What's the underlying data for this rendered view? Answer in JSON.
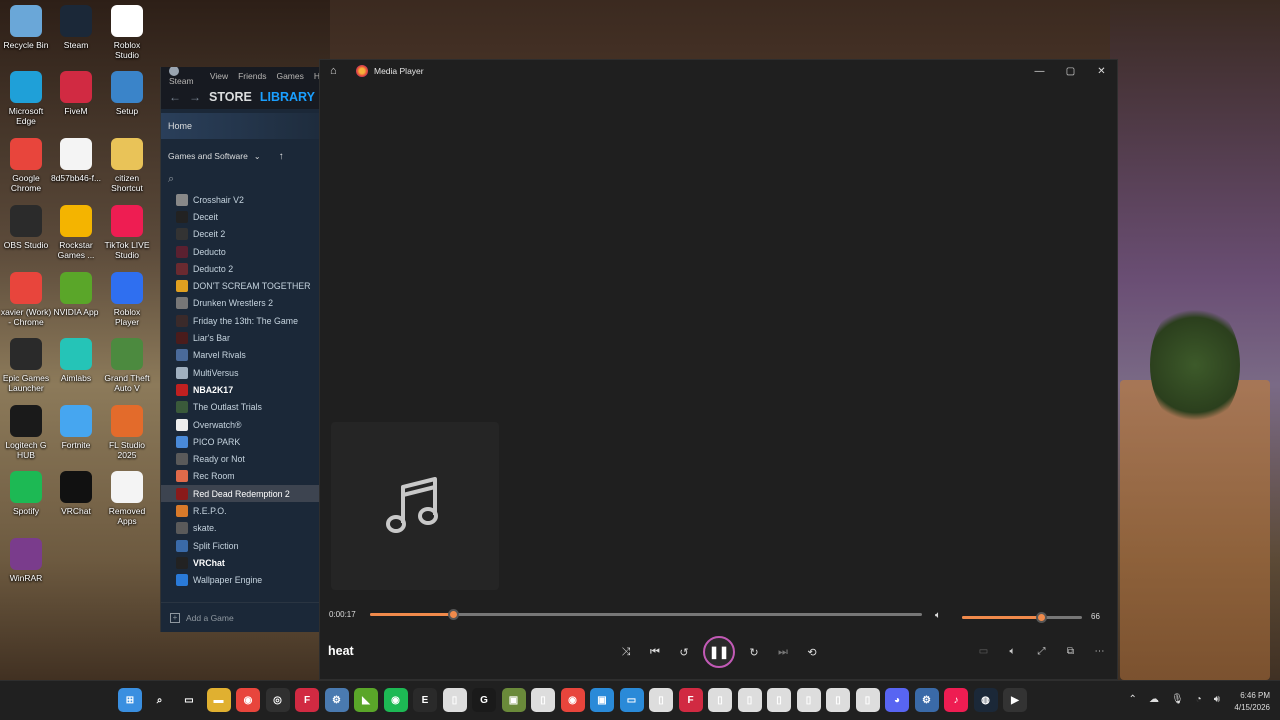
{
  "desktop": {
    "icons": [
      {
        "label": "Recycle Bin",
        "icon": "recycle-bin-icon",
        "color": "#6aa7d8"
      },
      {
        "label": "Steam",
        "icon": "steam-icon",
        "color": "#1b2838"
      },
      {
        "label": "Roblox Studio",
        "icon": "roblox-studio-icon",
        "color": "#ffffff"
      },
      {
        "label": "Microsoft Edge",
        "icon": "edge-icon",
        "color": "#1fa0d8"
      },
      {
        "label": "FiveM",
        "icon": "fivem-icon",
        "color": "#d12a42"
      },
      {
        "label": "Setup",
        "icon": "setup-icon",
        "color": "#3a84c9"
      },
      {
        "label": "Google Chrome",
        "icon": "chrome-icon",
        "color": "#e8453c"
      },
      {
        "label": "8d57bb46-f...",
        "icon": "file-icon",
        "color": "#f4f4f4"
      },
      {
        "label": "citizen Shortcut",
        "icon": "folder-icon",
        "color": "#e9c358"
      },
      {
        "label": "OBS Studio",
        "icon": "obs-icon",
        "color": "#2b2b2b"
      },
      {
        "label": "Rockstar Games ...",
        "icon": "rockstar-icon",
        "color": "#f4b400"
      },
      {
        "label": "TikTok LIVE Studio",
        "icon": "tiktok-icon",
        "color": "#ee1d52"
      },
      {
        "label": "xavier (Work) - Chrome",
        "icon": "chrome-profile-icon",
        "color": "#e8453c"
      },
      {
        "label": "NVIDIA App",
        "icon": "nvidia-icon",
        "color": "#5aa629"
      },
      {
        "label": "Roblox Player",
        "icon": "roblox-icon",
        "color": "#2f6ff0"
      },
      {
        "label": "Epic Games Launcher",
        "icon": "epic-icon",
        "color": "#2a2a2a"
      },
      {
        "label": "Aimlabs",
        "icon": "aimlabs-icon",
        "color": "#25c4b7"
      },
      {
        "label": "Grand Theft Auto V",
        "icon": "gta-icon",
        "color": "#4c8a3f"
      },
      {
        "label": "Logitech G HUB",
        "icon": "logitech-icon",
        "color": "#1a1a1a"
      },
      {
        "label": "Fortnite",
        "icon": "fortnite-icon",
        "color": "#46a6f0"
      },
      {
        "label": "FL Studio 2025",
        "icon": "fl-studio-icon",
        "color": "#e36b2b"
      },
      {
        "label": "Spotify",
        "icon": "spotify-icon",
        "color": "#1db954"
      },
      {
        "label": "VRChat",
        "icon": "vrchat-icon",
        "color": "#111111"
      },
      {
        "label": "Removed Apps",
        "icon": "removed-apps-icon",
        "color": "#f4f4f4"
      },
      {
        "label": "WinRAR",
        "icon": "winrar-icon",
        "color": "#7a3c8c"
      }
    ]
  },
  "steam": {
    "menu": [
      "Steam",
      "View",
      "Friends",
      "Games",
      "H"
    ],
    "tabs": {
      "store": "STORE",
      "library": "LIBRARY"
    },
    "home": "Home",
    "filter": "Games and Software",
    "games": [
      {
        "name": "Crosshair V2",
        "color": "#888888"
      },
      {
        "name": "Deceit",
        "color": "#222222"
      },
      {
        "name": "Deceit 2",
        "color": "#333333"
      },
      {
        "name": "Deducto",
        "color": "#5a2030"
      },
      {
        "name": "Deducto 2",
        "color": "#6a2a30"
      },
      {
        "name": "DON'T SCREAM TOGETHER",
        "color": "#e0a020"
      },
      {
        "name": "Drunken Wrestlers 2",
        "color": "#777777"
      },
      {
        "name": "Friday the 13th: The Game",
        "color": "#3a2a2a"
      },
      {
        "name": "Liar's Bar",
        "color": "#4a1c1c"
      },
      {
        "name": "Marvel Rivals",
        "color": "#4a6a9a"
      },
      {
        "name": "MultiVersus",
        "color": "#a0b0c0"
      },
      {
        "name": "NBA2K17",
        "color": "#c02020"
      },
      {
        "name": "The Outlast Trials",
        "color": "#3a5a3a"
      },
      {
        "name": "Overwatch®",
        "color": "#eeeeee"
      },
      {
        "name": "PICO PARK",
        "color": "#4a8ad8"
      },
      {
        "name": "Ready or Not",
        "color": "#5a5a5a"
      },
      {
        "name": "Rec Room",
        "color": "#e06a4a"
      },
      {
        "name": "Red Dead Redemption 2",
        "color": "#8a1a1a"
      },
      {
        "name": "R.E.P.O.",
        "color": "#d87a2a"
      },
      {
        "name": "skate.",
        "color": "#5a5a5a"
      },
      {
        "name": "Split Fiction",
        "color": "#3a6aa8"
      },
      {
        "name": "VRChat",
        "color": "#222222"
      },
      {
        "name": "Wallpaper Engine",
        "color": "#2a7ad8"
      }
    ],
    "selected_game": "Red Dead Redemption 2",
    "bold_games": [
      "NBA2K17",
      "VRChat"
    ],
    "add_game": "Add a Game"
  },
  "media_player": {
    "title": "Media Player",
    "current_time": "0:00:17",
    "progress_fraction": 0.15,
    "volume": "66",
    "volume_fraction": 0.66,
    "track_title": "heat",
    "accent": "#f08a4b",
    "play_ring": "#c25ab6"
  },
  "taskbar": {
    "icons": [
      {
        "name": "start-icon",
        "glyph": "⊞",
        "color": "#3a8fe0"
      },
      {
        "name": "search-icon",
        "glyph": "⌕",
        "color": "#202020"
      },
      {
        "name": "task-view-icon",
        "glyph": "▭",
        "color": "#202020"
      },
      {
        "name": "file-explorer-icon",
        "glyph": "▬",
        "color": "#e0b030"
      },
      {
        "name": "chrome-icon",
        "glyph": "◉",
        "color": "#e8453c"
      },
      {
        "name": "obs-icon",
        "glyph": "◎",
        "color": "#303030"
      },
      {
        "name": "fivem-icon",
        "glyph": "F",
        "color": "#d12a42"
      },
      {
        "name": "settings-icon",
        "glyph": "⚙",
        "color": "#4a7ab0"
      },
      {
        "name": "nvidia-icon",
        "glyph": "◣",
        "color": "#5aa629"
      },
      {
        "name": "spotify-icon",
        "glyph": "◉",
        "color": "#1db954"
      },
      {
        "name": "epic-icon",
        "glyph": "E",
        "color": "#2a2a2a"
      },
      {
        "name": "file-icon",
        "glyph": "▯",
        "color": "#dddddd"
      },
      {
        "name": "logitech-icon",
        "glyph": "G",
        "color": "#1a1a1a"
      },
      {
        "name": "minecraft-icon",
        "glyph": "▣",
        "color": "#6a8a3a"
      },
      {
        "name": "file-icon-2",
        "glyph": "▯",
        "color": "#dddddd"
      },
      {
        "name": "chrome-profile-icon",
        "glyph": "◉",
        "color": "#e8453c"
      },
      {
        "name": "app-icon",
        "glyph": "▣",
        "color": "#2a8ad8"
      },
      {
        "name": "window-icon",
        "glyph": "▭",
        "color": "#2a8ad8"
      },
      {
        "name": "file-icon-3",
        "glyph": "▯",
        "color": "#dddddd"
      },
      {
        "name": "fivem-icon-2",
        "glyph": "F",
        "color": "#d12a42"
      },
      {
        "name": "file-icon-4",
        "glyph": "▯",
        "color": "#dddddd"
      },
      {
        "name": "file-icon-5",
        "glyph": "▯",
        "color": "#dddddd"
      },
      {
        "name": "file-icon-6",
        "glyph": "▯",
        "color": "#dddddd"
      },
      {
        "name": "file-icon-7",
        "glyph": "▯",
        "color": "#dddddd"
      },
      {
        "name": "file-icon-8",
        "glyph": "▯",
        "color": "#dddddd"
      },
      {
        "name": "file-icon-9",
        "glyph": "▯",
        "color": "#dddddd"
      },
      {
        "name": "discord-icon",
        "glyph": "◕",
        "color": "#5865f2"
      },
      {
        "name": "settings-icon-2",
        "glyph": "⚙",
        "color": "#3a6aa8"
      },
      {
        "name": "tiktok-icon",
        "glyph": "♪",
        "color": "#ee1d52"
      },
      {
        "name": "steam-icon",
        "glyph": "◍",
        "color": "#1b2838"
      },
      {
        "name": "media-player-icon",
        "glyph": "▶",
        "color": "#333333"
      }
    ],
    "time": "6:46 PM",
    "date": "4/15/2026"
  }
}
